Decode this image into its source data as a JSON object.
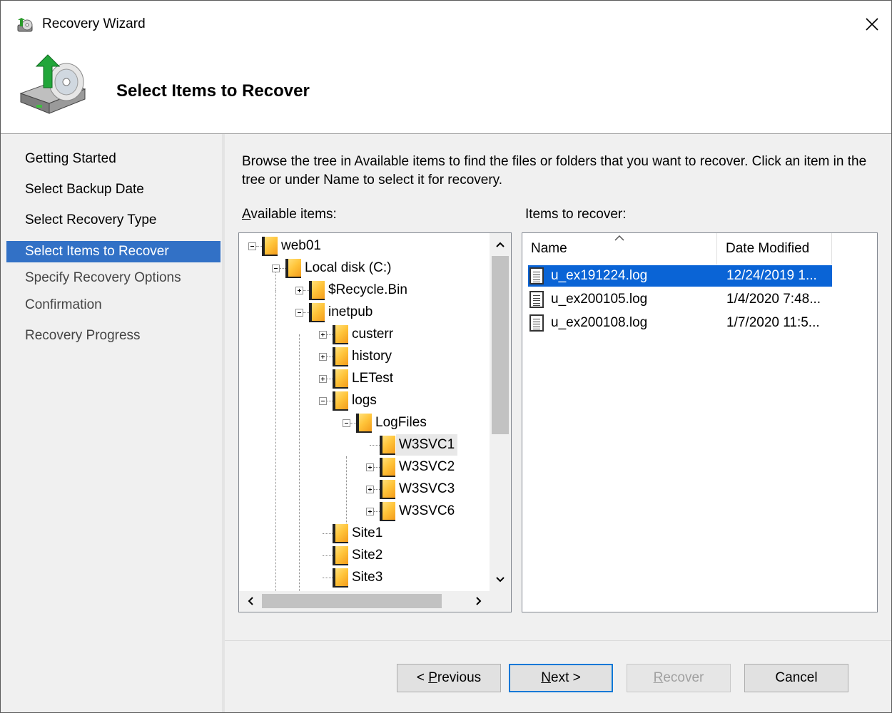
{
  "window": {
    "title": "Recovery Wizard"
  },
  "header": {
    "title": "Select Items to Recover"
  },
  "steps": [
    {
      "label": "Getting Started",
      "state": "done"
    },
    {
      "label": "Select Backup Date",
      "state": "done"
    },
    {
      "label": "Select Recovery Type",
      "state": "done"
    },
    {
      "label": "Select Items to Recover",
      "state": "current"
    },
    {
      "label": "Specify Recovery Options",
      "state": "todo"
    },
    {
      "label": "Confirmation",
      "state": "todo"
    },
    {
      "label": "Recovery Progress",
      "state": "todo"
    }
  ],
  "instructions": "Browse the tree in Available items to find the files or folders that you want to recover. Click an item in the tree or under Name to select it for recovery.",
  "available": {
    "label_prefix": "A",
    "label_rest": "vailable items:",
    "tree": [
      {
        "label": "web01",
        "level": 0,
        "expander": "minus"
      },
      {
        "label": "Local disk (C:)",
        "level": 1,
        "expander": "minus"
      },
      {
        "label": "$Recycle.Bin",
        "level": 2,
        "expander": "plus"
      },
      {
        "label": "inetpub",
        "level": 2,
        "expander": "minus"
      },
      {
        "label": "custerr",
        "level": 3,
        "expander": "plus"
      },
      {
        "label": "history",
        "level": 3,
        "expander": "plus"
      },
      {
        "label": "LETest",
        "level": 3,
        "expander": "plus"
      },
      {
        "label": "logs",
        "level": 3,
        "expander": "minus"
      },
      {
        "label": "LogFiles",
        "level": 4,
        "expander": "minus"
      },
      {
        "label": "W3SVC1",
        "level": 5,
        "expander": "none",
        "selected": true
      },
      {
        "label": "W3SVC2",
        "level": 5,
        "expander": "plus"
      },
      {
        "label": "W3SVC3",
        "level": 5,
        "expander": "plus"
      },
      {
        "label": "W3SVC6",
        "level": 5,
        "expander": "plus"
      },
      {
        "label": "Site1",
        "level": 3,
        "expander": "none"
      },
      {
        "label": "Site2",
        "level": 3,
        "expander": "none"
      },
      {
        "label": "Site3",
        "level": 3,
        "expander": "none"
      }
    ]
  },
  "recover": {
    "label": "Items to recover:",
    "columns": {
      "name": "Name",
      "date": "Date Modified"
    },
    "rows": [
      {
        "name": "u_ex191224.log",
        "date": "12/24/2019 1...",
        "selected": true
      },
      {
        "name": "u_ex200105.log",
        "date": "1/4/2020 7:48...",
        "selected": false
      },
      {
        "name": "u_ex200108.log",
        "date": "1/7/2020 11:5...",
        "selected": false
      }
    ]
  },
  "buttons": {
    "previous": {
      "prefix": "< ",
      "accel": "P",
      "rest": "revious"
    },
    "next": {
      "accel": "N",
      "rest": "ext >"
    },
    "recover": {
      "accel": "R",
      "rest": "ecover"
    },
    "cancel": {
      "label": "Cancel"
    }
  },
  "colors": {
    "selection": "#0a64d6",
    "step_current": "#3271c6",
    "pane_bg": "#f0f0f0"
  },
  "icons": {
    "title": "recovery-wizard-icon",
    "header": "backup-disk-icon",
    "close": "close-icon",
    "folder": "folder-icon",
    "file": "document-icon"
  }
}
